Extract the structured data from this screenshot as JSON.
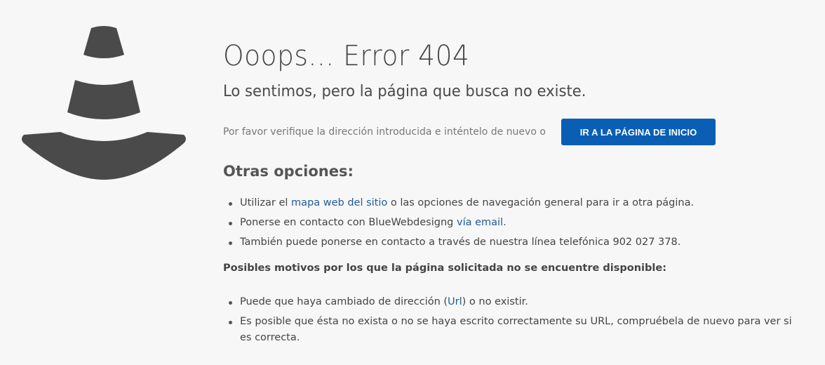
{
  "error": {
    "title": "Ooops... Error 404",
    "subtitle": "Lo sentimos, pero la página que busca no existe.",
    "verify_text": "Por favor verifique la dirección introducida e inténtelo de nuevo o",
    "home_button_label": "IR A LA PÁGINA DE INICIO"
  },
  "options": {
    "heading": "Otras opciones:",
    "items": [
      {
        "before": "Utilizar el ",
        "link": "mapa web del sitio",
        "after": " o las opciones de navegación general para ir a otra página."
      },
      {
        "before": "Ponerse en contacto con BlueWebdesigng ",
        "link": "vía email",
        "after": "."
      },
      {
        "text": "También puede ponerse en contacto a través de nuestra línea telefónica 902 027 378."
      }
    ]
  },
  "reasons": {
    "heading": "Posibles motivos por los que la página solicitada no se encuentre disponible:",
    "items": [
      {
        "before": "Puede que haya cambiado de dirección (",
        "link": "Url",
        "after": ") o no existir."
      },
      {
        "text": "Es posible que ésta no exista o no se haya escrito correctamente su URL, compruébela de nuevo para ver si es correcta."
      }
    ]
  },
  "icon": {
    "name": "traffic-cone-icon",
    "color": "#4a4a4a"
  },
  "colors": {
    "background": "#f7f7f7",
    "button": "#0a5fb4",
    "link": "#1f5c99"
  }
}
